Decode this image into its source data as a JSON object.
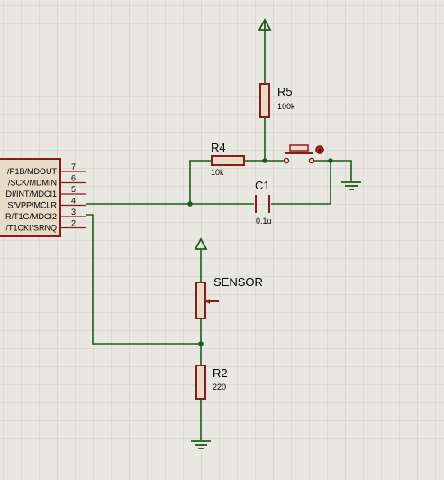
{
  "components": {
    "r5": {
      "ref": "R5",
      "value": "100k"
    },
    "r4": {
      "ref": "R4",
      "value": "10k"
    },
    "c1": {
      "ref": "C1",
      "value": "0.1u"
    },
    "sensor": {
      "ref": "SENSOR"
    },
    "r2": {
      "ref": "R2",
      "value": "220"
    }
  },
  "mcu": {
    "pins": [
      {
        "label": "/P1B/MDOUT",
        "number": "7"
      },
      {
        "label": "/SCK/MDMIN",
        "number": "6"
      },
      {
        "label": "DI/INT/MDCI1",
        "number": "5"
      },
      {
        "label": "S/VPP/MCLR",
        "number": "4"
      },
      {
        "label": "R/T1G/MDCI2",
        "number": "3"
      },
      {
        "label": "/T1CKI/SRNQ",
        "number": "2"
      }
    ]
  },
  "colors": {
    "background": "#e8e8e0",
    "grid": "#c8c8be",
    "wire": "#1a5c1a",
    "component": "#8b1a1a",
    "component_fill": "#e8dcc8"
  }
}
